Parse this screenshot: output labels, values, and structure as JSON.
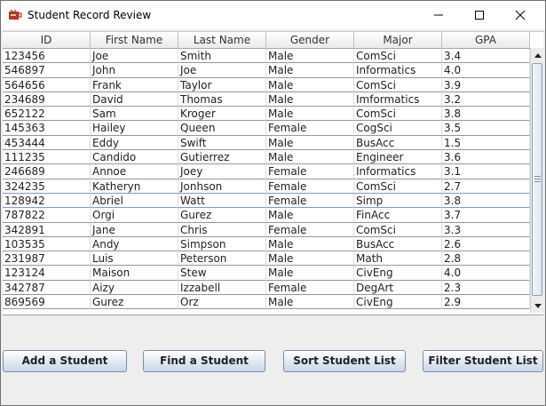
{
  "window": {
    "title": "Student Record Review"
  },
  "table": {
    "columns": [
      "ID",
      "First Name",
      "Last Name",
      "Gender",
      "Major",
      "GPA"
    ],
    "rows": [
      [
        "123456",
        "Joe",
        "Smith",
        "Male",
        "ComSci",
        "3.4"
      ],
      [
        "546897",
        "John",
        "Joe",
        "Male",
        "Informatics",
        "4.0"
      ],
      [
        "564656",
        "Frank",
        "Taylor",
        "Male",
        "ComSci",
        "3.9"
      ],
      [
        "234689",
        "David",
        "Thomas",
        "Male",
        "Imformatics",
        "3.2"
      ],
      [
        "652122",
        "Sam",
        "Kroger",
        "Male",
        "ComSci",
        "3.8"
      ],
      [
        "145363",
        "Hailey",
        "Queen",
        "Female",
        "CogSci",
        "3.5"
      ],
      [
        "453444",
        "Eddy",
        "Swift",
        "Male",
        "BusAcc",
        "1.5"
      ],
      [
        "111235",
        "Candido",
        "Gutierrez",
        "Male",
        "Engineer",
        "3.6"
      ],
      [
        "246689",
        "Annoe",
        "Joey",
        "Female",
        "Informatics",
        "3.1"
      ],
      [
        "324235",
        "Katheryn",
        "Jonhson",
        "Female",
        "ComSci",
        "2.7"
      ],
      [
        "128942",
        "Abriel",
        "Watt",
        "Female",
        "Simp",
        "3.8"
      ],
      [
        "787822",
        "Orgi",
        "Gurez",
        "Male",
        "FinAcc",
        "3.7"
      ],
      [
        "342891",
        "Jane",
        "Chris",
        "Female",
        "ComSci",
        "3.3"
      ],
      [
        "103535",
        "Andy",
        "Simpson",
        "Male",
        "BusAcc",
        "2.6"
      ],
      [
        "231987",
        "Luis",
        "Peterson",
        "Male",
        "Math",
        "2.8"
      ],
      [
        "123124",
        "Maison",
        "Stew",
        "Male",
        "CivEng",
        "4.0"
      ],
      [
        "342787",
        "Aizy",
        "Izzabell",
        "Female",
        "DegArt",
        "2.3"
      ],
      [
        "869569",
        "Gurez",
        "Orz",
        "Male",
        "CivEng",
        "2.9"
      ]
    ]
  },
  "buttons": {
    "add": "Add a Student",
    "find": "Find a Student",
    "sort": "Sort Student List",
    "filter": "Filter Student List"
  },
  "icons": {
    "app": "coffee-cup-icon",
    "minimize": "minimize-icon",
    "maximize": "maximize-icon",
    "close": "close-icon",
    "scroll_up": "arrow-up-icon",
    "scroll_down": "arrow-down-icon"
  }
}
